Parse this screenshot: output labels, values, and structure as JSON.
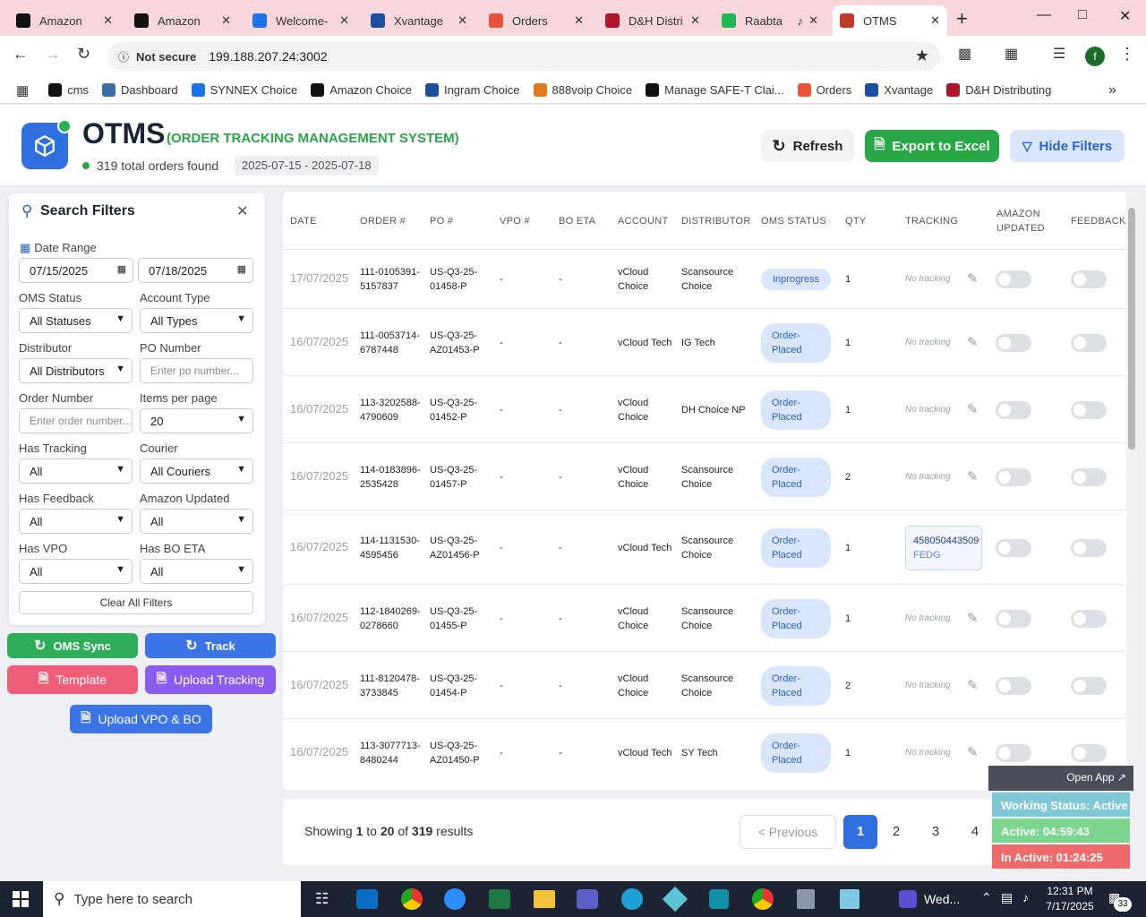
{
  "browser": {
    "tabs": [
      {
        "label": "Amazon",
        "icon": "amazon-icon",
        "color": "#111111"
      },
      {
        "label": "Amazon",
        "icon": "amazon-icon",
        "color": "#111111"
      },
      {
        "label": "Welcome-",
        "icon": "ec-icon",
        "color": "#1a73e8"
      },
      {
        "label": "Xvantage",
        "icon": "xvantage-icon",
        "color": "#1a4fa0"
      },
      {
        "label": "Orders",
        "icon": "orders-icon",
        "color": "#e8533a"
      },
      {
        "label": "D&H Distri",
        "icon": "dh-icon",
        "color": "#b0142a"
      },
      {
        "label": "Raabta",
        "icon": "spotify-icon",
        "color": "#1db954"
      },
      {
        "label": "OTMS",
        "icon": "otms-icon",
        "color": "#c0392b"
      }
    ],
    "url_warning": "Not secure",
    "url": "199.188.207.24:3002",
    "profile_initial": "f",
    "bookmarks": [
      {
        "label": "cms",
        "color": "#111111"
      },
      {
        "label": "Dashboard",
        "color": "#3a6ea5"
      },
      {
        "label": "SYNNEX Choice",
        "color": "#1a73e8"
      },
      {
        "label": "Amazon Choice",
        "color": "#111111"
      },
      {
        "label": "Ingram Choice",
        "color": "#1a4fa0"
      },
      {
        "label": "888voip Choice",
        "color": "#e07a1f"
      },
      {
        "label": "Manage SAFE-T Clai...",
        "color": "#111111"
      },
      {
        "label": "Orders",
        "color": "#e8533a"
      },
      {
        "label": "Xvantage",
        "color": "#1a4fa0"
      },
      {
        "label": "D&H Distributing",
        "color": "#b0142a"
      }
    ]
  },
  "header": {
    "title": "OTMS",
    "subtitle": "(ORDER TRACKING MANAGEMENT SYSTEM)",
    "orders_found": "319 total orders found",
    "date_range": "2025-07-15 - 2025-07-18",
    "refresh_label": "Refresh",
    "export_label": "Export to Excel",
    "hide_filters_label": "Hide Filters"
  },
  "filters": {
    "title": "Search Filters",
    "date_range_label": "Date Range",
    "date_from": "07/15/2025",
    "date_to": "07/18/2025",
    "oms_status_label": "OMS Status",
    "oms_status_value": "All Statuses",
    "account_type_label": "Account Type",
    "account_type_value": "All Types",
    "distributor_label": "Distributor",
    "distributor_value": "All Distributors",
    "po_number_label": "PO Number",
    "po_number_placeholder": "Enter po number...",
    "order_number_label": "Order Number",
    "order_number_placeholder": "Enter order number...",
    "items_per_page_label": "Items per page",
    "items_per_page_value": "20",
    "has_tracking_label": "Has Tracking",
    "has_tracking_value": "All",
    "courier_label": "Courier",
    "courier_value": "All Couriers",
    "has_feedback_label": "Has Feedback",
    "has_feedback_value": "All",
    "amazon_updated_label": "Amazon Updated",
    "amazon_updated_value": "All",
    "has_vpo_label": "Has VPO",
    "has_vpo_value": "All",
    "has_bo_eta_label": "Has BO ETA",
    "has_bo_eta_value": "All",
    "clear_label": "Clear All Filters"
  },
  "actions": {
    "oms_sync": "OMS Sync",
    "track": "Track",
    "template": "Template",
    "upload_tracking": "Upload Tracking",
    "upload_vpo_bo": "Upload VPO & BO"
  },
  "table": {
    "columns": [
      "DATE",
      "ORDER #",
      "PO #",
      "VPO #",
      "BO ETA",
      "ACCOUNT",
      "DISTRIBUTOR",
      "OMS STATUS",
      "QTY",
      "TRACKING",
      "AMAZON\nUPDATED",
      "FEEDBACK"
    ],
    "rows": [
      {
        "date": "17/07/2025",
        "order": "111-0105391-\n5157837",
        "po": "US-Q3-25-\n01458-P",
        "vpo": "-",
        "bo_eta": "-",
        "account": "vCloud\nChoice",
        "distributor": "Scansource\nChoice",
        "status": "Inprogress",
        "qty": "1",
        "tracking": "No tracking",
        "tracking_carrier": ""
      },
      {
        "date": "16/07/2025",
        "order": "111-0053714-\n6787448",
        "po": "US-Q3-25-\nAZ01453-P",
        "vpo": "-",
        "bo_eta": "-",
        "account": "vCloud Tech",
        "distributor": "IG Tech",
        "status": "Order-\nPlaced",
        "qty": "1",
        "tracking": "No tracking",
        "tracking_carrier": ""
      },
      {
        "date": "16/07/2025",
        "order": "113-3202588-\n4790609",
        "po": "US-Q3-25-\n01452-P",
        "vpo": "-",
        "bo_eta": "-",
        "account": "vCloud\nChoice",
        "distributor": "DH Choice NP",
        "status": "Order-\nPlaced",
        "qty": "1",
        "tracking": "No tracking",
        "tracking_carrier": ""
      },
      {
        "date": "16/07/2025",
        "order": "114-0183896-\n2535428",
        "po": "US-Q3-25-\n01457-P",
        "vpo": "-",
        "bo_eta": "-",
        "account": "vCloud\nChoice",
        "distributor": "Scansource\nChoice",
        "status": "Order-\nPlaced",
        "qty": "2",
        "tracking": "No tracking",
        "tracking_carrier": ""
      },
      {
        "date": "16/07/2025",
        "order": "114-1131530-\n4595456",
        "po": "US-Q3-25-\nAZ01456-P",
        "vpo": "-",
        "bo_eta": "-",
        "account": "vCloud Tech",
        "distributor": "Scansource\nChoice",
        "status": "Order-\nPlaced",
        "qty": "1",
        "tracking": "458050443509",
        "tracking_carrier": "FEDG"
      },
      {
        "date": "16/07/2025",
        "order": "112-1840269-\n0278660",
        "po": "US-Q3-25-\n01455-P",
        "vpo": "-",
        "bo_eta": "-",
        "account": "vCloud\nChoice",
        "distributor": "Scansource\nChoice",
        "status": "Order-\nPlaced",
        "qty": "1",
        "tracking": "No tracking",
        "tracking_carrier": ""
      },
      {
        "date": "16/07/2025",
        "order": "111-8120478-\n3733845",
        "po": "US-Q3-25-\n01454-P",
        "vpo": "-",
        "bo_eta": "-",
        "account": "vCloud\nChoice",
        "distributor": "Scansource\nChoice",
        "status": "Order-\nPlaced",
        "qty": "2",
        "tracking": "No tracking",
        "tracking_carrier": ""
      },
      {
        "date": "16/07/2025",
        "order": "113-3077713-\n8480244",
        "po": "US-Q3-25-\nAZ01450-P",
        "vpo": "-",
        "bo_eta": "-",
        "account": "vCloud Tech",
        "distributor": "SY Tech",
        "status": "Order-\nPlaced",
        "qty": "1",
        "tracking": "No tracking",
        "tracking_carrier": ""
      }
    ]
  },
  "pagination": {
    "showing_prefix": "Showing ",
    "from": "1",
    "to_word": " to ",
    "to": "20",
    "of_word": " of ",
    "total": "319",
    "results_word": " results",
    "previous_label": "< Previous",
    "pages": [
      "1",
      "2",
      "3",
      "4"
    ]
  },
  "status_widget": {
    "open_app": "Open App ↗",
    "working_status": "Working Status: Active",
    "active": "Active: 04:59:43",
    "inactive": "In Active: 01:24:25"
  },
  "taskbar": {
    "search_placeholder": "Type here to search",
    "weather": "Wed...",
    "time": "12:31 PM",
    "date": "7/17/2025",
    "notifications": "33"
  },
  "colors": {
    "accent_blue": "#2f6fe0",
    "green": "#27a745",
    "teal_green": "#2fae5a",
    "pink": "#ef5d79",
    "purple": "#8a5cf0",
    "status_blue": "#d9e6fb"
  }
}
